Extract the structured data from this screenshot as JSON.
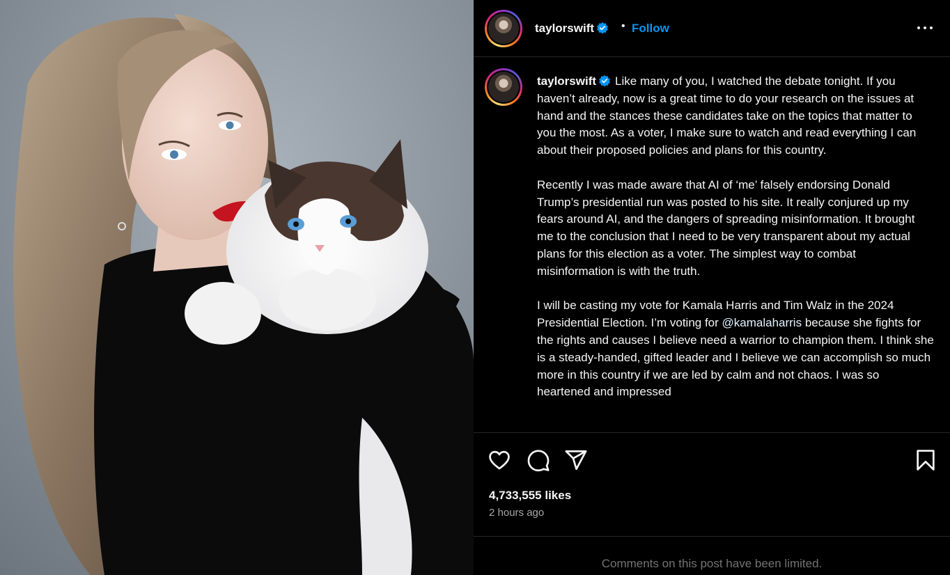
{
  "post": {
    "image_alt": "Photo of a woman with long wavy hair and red lipstick holding a fluffy white and brown cat",
    "username": "taylorswift",
    "verified": true,
    "follow_label": "Follow",
    "separator": "•",
    "caption": {
      "intro": "Like many of you, I watched the debate tonight. If you haven’t already, now is a great time to do your research on the issues at hand and the stances these candidates take on the topics that matter to you the most. As a voter, I make sure to watch and read everything I can about their proposed policies and plans for this country.",
      "paragraph2": "Recently I was made aware that AI of ‘me’ falsely endorsing Donald Trump’s presidential run was posted to his site. It really conjured up my fears around AI, and the dangers of spreading misinformation. It brought me to the conclusion that I need to be very transparent about my actual plans for this election as a voter. The simplest way to combat misinformation is with the truth.",
      "paragraph3_before": "I will be casting my vote for Kamala Harris and Tim Walz in the 2024 Presidential Election. I’m voting for ",
      "mention": "@kamalaharris",
      "paragraph3_after": " because she fights for the rights and causes I believe need a warrior to champion them. I think she is a steady-handed, gifted leader and I believe we can accomplish so much more in this country if we are led by calm and not chaos. I was so heartened and impressed"
    },
    "likes": "4,733,555 likes",
    "timestamp": "2 hours ago",
    "comments_notice": "Comments on this post have been limited."
  },
  "icons": {
    "verified": "verified-badge-icon",
    "more": "more-options-icon",
    "like": "heart-icon",
    "comment": "comment-bubble-icon",
    "share": "paper-plane-icon",
    "save": "bookmark-icon"
  },
  "colors": {
    "background": "#000000",
    "link_blue": "#0095f6",
    "verified_blue": "#0095f6",
    "secondary_text": "#a8a8a8",
    "muted_text": "#737373",
    "divider": "#262626"
  }
}
